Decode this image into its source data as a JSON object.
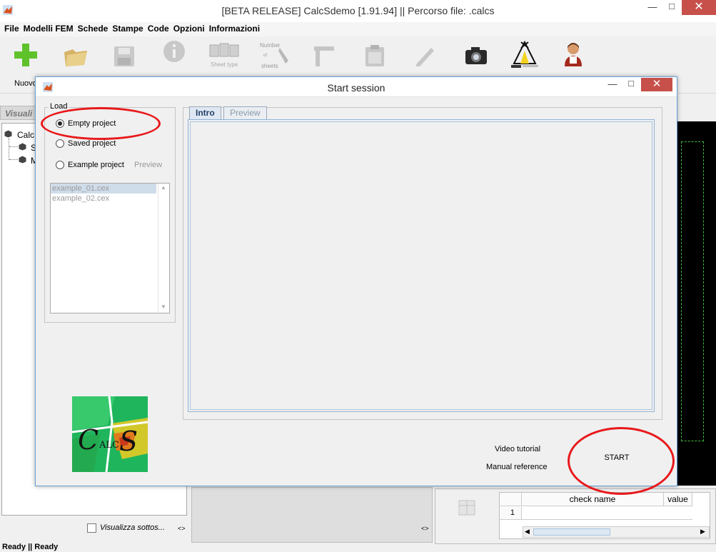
{
  "window": {
    "title": "[BETA RELEASE] CalcSdemo [1.91.94] || Percorso file: .calcs",
    "minimize": "—",
    "maximize": "□",
    "close": "✕"
  },
  "menu": [
    "File",
    "Modelli FEM",
    "Schede",
    "Stampe",
    "Code",
    "Opzioni",
    "Informazioni"
  ],
  "toolbar": {
    "nuovo_label": "Nuovo",
    "sheet_type_label": "Sheet type",
    "number_of_sheets_label": [
      "Number",
      "of",
      "sheets"
    ]
  },
  "left_panel": {
    "header": "Visuali",
    "tree": [
      "Calc",
      "S",
      "M"
    ],
    "show_sub_label": "Visualizza sottos...",
    "resize_glyph": "<>"
  },
  "bottom_table": {
    "columns": [
      "check name",
      "value"
    ],
    "rows": [
      "1"
    ]
  },
  "status": "Ready || Ready",
  "dialog": {
    "title": "Start session",
    "minimize": "—",
    "maximize": "□",
    "close": "✕",
    "load_group_label": "Load",
    "options": [
      {
        "label": "Empty project",
        "checked": true
      },
      {
        "label": "Saved project",
        "checked": false
      },
      {
        "label": "Example project",
        "checked": false
      }
    ],
    "preview_link": "Preview",
    "examples": [
      "example_01.cex",
      "example_02.cex"
    ],
    "tabs": [
      {
        "label": "Intro",
        "active": true
      },
      {
        "label": "Preview",
        "active": false
      }
    ],
    "video_tutorial": "Video tutorial",
    "manual_reference": "Manual reference",
    "start_label": "START"
  },
  "colors": {
    "annotation_red": "#e8191b",
    "close_red": "#c7504b",
    "green_plus": "#5fc22a"
  }
}
